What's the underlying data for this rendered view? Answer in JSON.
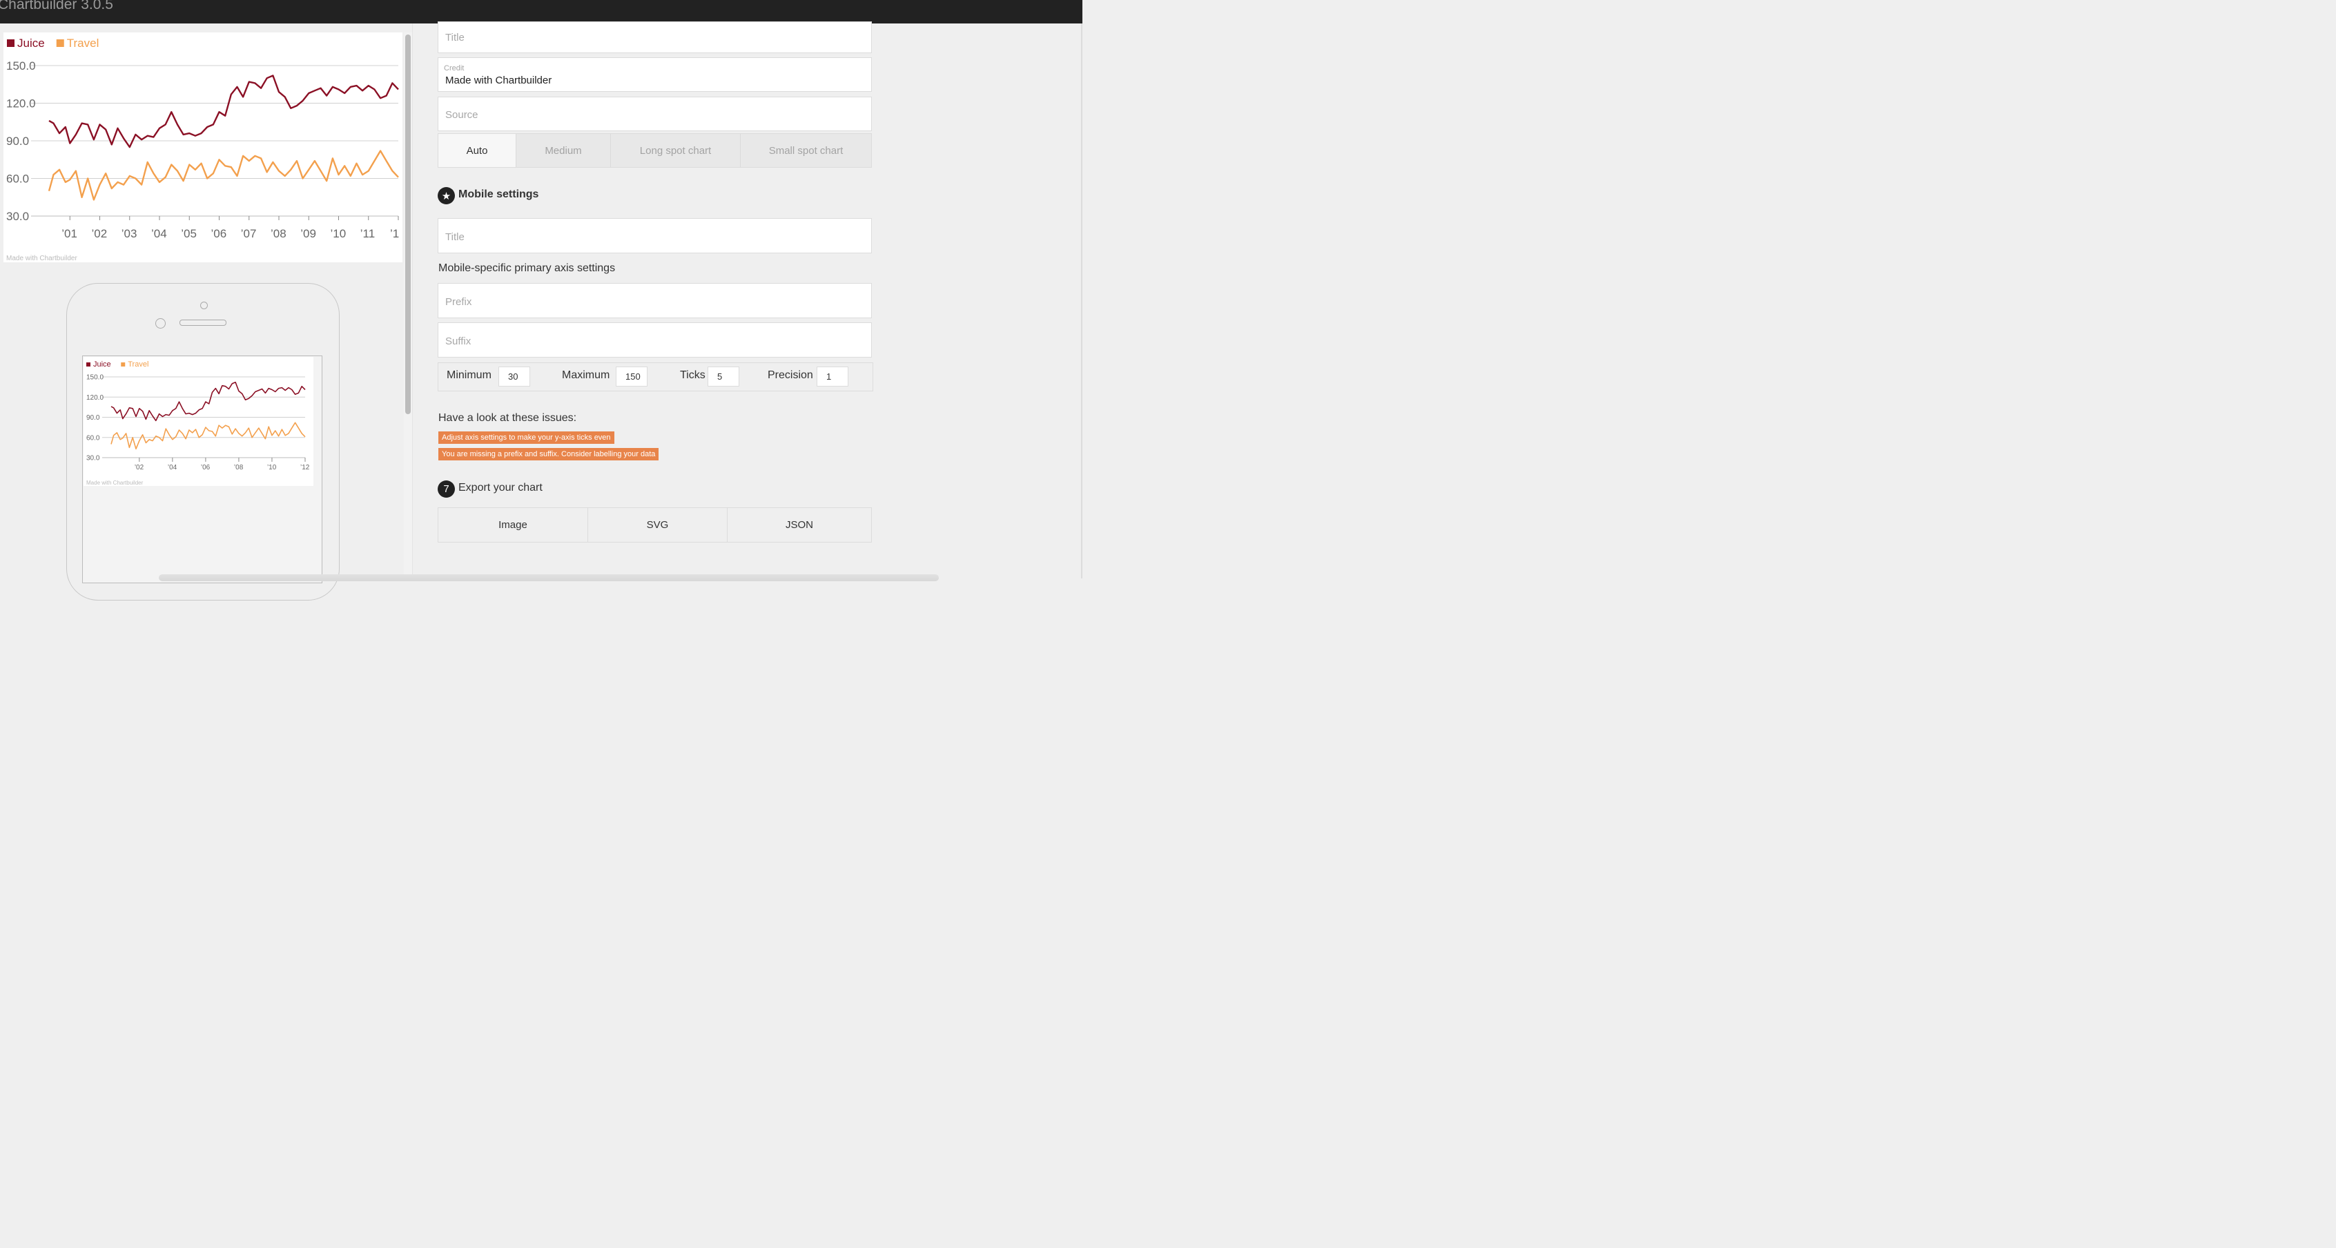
{
  "app": {
    "title": "Chartbuilder 3.0.5"
  },
  "chart_data": [
    {
      "type": "line",
      "legend_position": "top-left",
      "yticks": [
        "150.0",
        "120.0",
        "90.0",
        "60.0",
        "30.0"
      ],
      "ylim": [
        30,
        150
      ],
      "xticks": [
        "’01",
        "’02",
        "’03",
        "’04",
        "’05",
        "’06",
        "’07",
        "’08",
        "’09",
        "’10",
        "’11",
        "’1"
      ],
      "xlim": [
        2000.3,
        2012.0
      ],
      "grid": true,
      "credit": "Made with Chartbuilder",
      "series": [
        {
          "name": "Juice",
          "color": "#8b1025",
          "x": [
            2000.3,
            2000.45,
            2000.65,
            2000.85,
            2001.0,
            2001.2,
            2001.4,
            2001.6,
            2001.8,
            2002.0,
            2002.2,
            2002.4,
            2002.6,
            2002.8,
            2003.0,
            2003.2,
            2003.4,
            2003.6,
            2003.8,
            2004.0,
            2004.2,
            2004.4,
            2004.6,
            2004.8,
            2005.0,
            2005.2,
            2005.4,
            2005.6,
            2005.8,
            2006.0,
            2006.2,
            2006.4,
            2006.6,
            2006.8,
            2007.0,
            2007.2,
            2007.4,
            2007.6,
            2007.8,
            2008.0,
            2008.2,
            2008.4,
            2008.6,
            2008.8,
            2009.0,
            2009.2,
            2009.4,
            2009.6,
            2009.8,
            2010.0,
            2010.2,
            2010.4,
            2010.6,
            2010.8,
            2011.0,
            2011.2,
            2011.4,
            2011.6,
            2011.8,
            2012.0
          ],
          "values": [
            106,
            104,
            96,
            101,
            88,
            95,
            104,
            103,
            91,
            103,
            99,
            87,
            100,
            92,
            85,
            95,
            91,
            94,
            93,
            100,
            103,
            113,
            103,
            95,
            96,
            94,
            96,
            101,
            103,
            113,
            110,
            127,
            133,
            125,
            137,
            136,
            132,
            140,
            142,
            129,
            125,
            116,
            118,
            122,
            128,
            130,
            132,
            126,
            133,
            131,
            128,
            133,
            134,
            130,
            134,
            131,
            124,
            126,
            136,
            131
          ]
        },
        {
          "name": "Travel",
          "color": "#f3a04d",
          "x": [
            2000.3,
            2000.45,
            2000.65,
            2000.85,
            2001.0,
            2001.2,
            2001.4,
            2001.6,
            2001.8,
            2002.0,
            2002.2,
            2002.4,
            2002.6,
            2002.8,
            2003.0,
            2003.2,
            2003.4,
            2003.6,
            2003.8,
            2004.0,
            2004.2,
            2004.4,
            2004.6,
            2004.8,
            2005.0,
            2005.2,
            2005.4,
            2005.6,
            2005.8,
            2006.0,
            2006.2,
            2006.4,
            2006.6,
            2006.8,
            2007.0,
            2007.2,
            2007.4,
            2007.6,
            2007.8,
            2008.0,
            2008.2,
            2008.4,
            2008.6,
            2008.8,
            2009.0,
            2009.2,
            2009.4,
            2009.6,
            2009.8,
            2010.0,
            2010.2,
            2010.4,
            2010.6,
            2010.8,
            2011.0,
            2011.2,
            2011.4,
            2011.6,
            2011.8,
            2012.0
          ],
          "values": [
            50,
            63,
            67,
            57,
            59,
            66,
            45,
            60,
            43,
            55,
            64,
            52,
            57,
            55,
            62,
            60,
            55,
            73,
            64,
            57,
            61,
            71,
            66,
            58,
            71,
            67,
            72,
            60,
            64,
            75,
            70,
            69,
            62,
            78,
            74,
            78,
            76,
            65,
            73,
            66,
            62,
            67,
            74,
            60,
            67,
            74,
            66,
            58,
            76,
            63,
            70,
            62,
            72,
            63,
            66,
            74,
            82,
            74,
            66,
            61
          ]
        }
      ]
    },
    {
      "type": "line",
      "legend_position": "top-left",
      "yticks": [
        "150.0",
        "120.0",
        "90.0",
        "60.0",
        "30.0"
      ],
      "ylim": [
        30,
        150
      ],
      "xticks": [
        "’02",
        "’04",
        "’06",
        "’08",
        "’10",
        "’12"
      ],
      "xlim": [
        2000.3,
        2012.0
      ],
      "grid": true,
      "credit": "Made with Chartbuilder",
      "series": [
        {
          "name": "Juice",
          "color": "#8b1025",
          "ref": 0
        },
        {
          "name": "Travel",
          "color": "#f3a04d",
          "ref": 1
        }
      ]
    }
  ],
  "form": {
    "title_placeholder": "Title",
    "credit_label": "Credit",
    "credit_value": "Made with Chartbuilder",
    "source_placeholder": "Source",
    "size_tabs": [
      "Auto",
      "Medium",
      "Long spot chart",
      "Small spot chart"
    ],
    "active_size_tab": "Auto",
    "mobile_heading": "Mobile settings",
    "mobile_badge_icon": "star-icon",
    "mobile_title_placeholder": "Title",
    "mobile_axis_heading": "Mobile-specific primary axis settings",
    "prefix_placeholder": "Prefix",
    "suffix_placeholder": "Suffix",
    "axis": {
      "min_label": "Minimum",
      "min_value": "30",
      "max_label": "Maximum",
      "max_value": "150",
      "ticks_label": "Ticks",
      "ticks_value": "5",
      "precision_label": "Precision",
      "precision_value": "1"
    },
    "issues_heading": "Have a look at these issues:",
    "issues": [
      "Adjust axis settings to make your y-axis ticks even",
      "You are missing a prefix and suffix. Consider labelling your data"
    ],
    "issue_color": "#e8844a",
    "export_step": "7",
    "export_heading": "Export your chart",
    "export_buttons": [
      "Image",
      "SVG",
      "JSON"
    ]
  }
}
